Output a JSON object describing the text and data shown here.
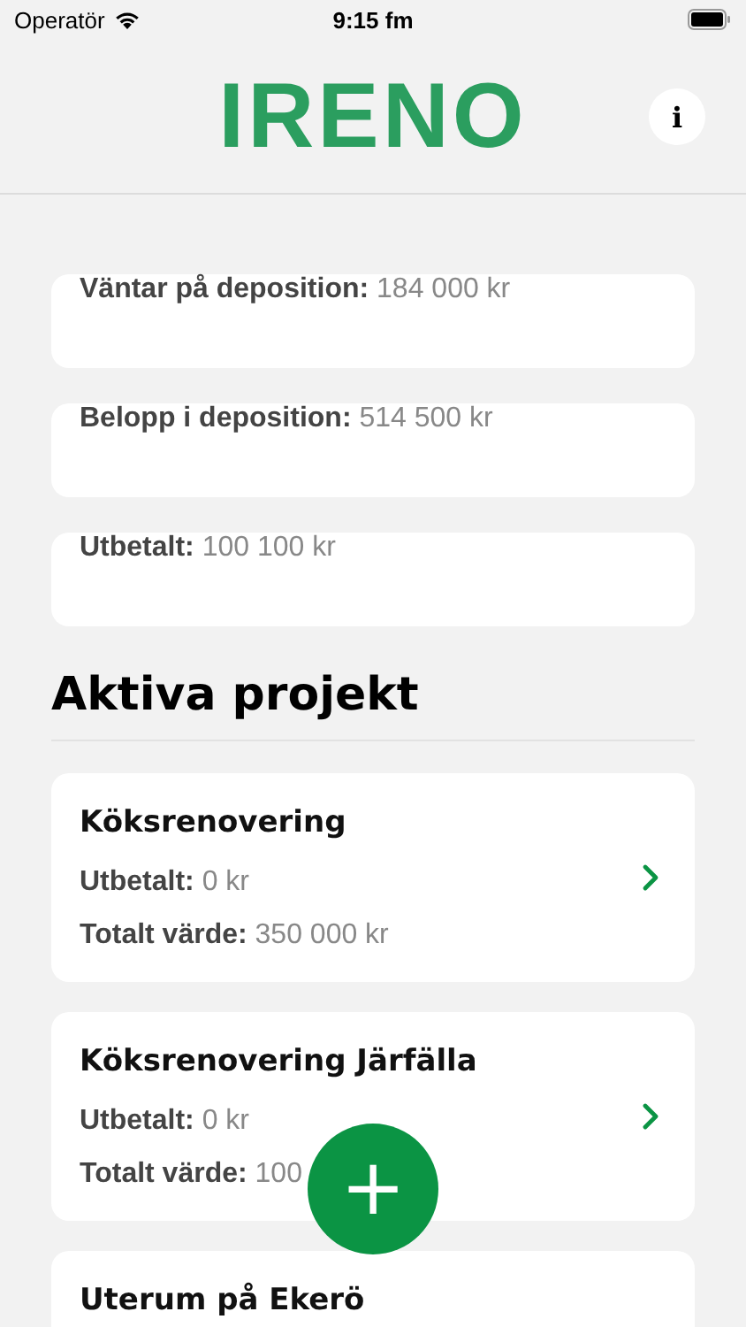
{
  "status_bar": {
    "carrier": "Operatör",
    "time": "9:15 fm"
  },
  "header": {
    "logo": "IRENO",
    "info_icon": "i"
  },
  "summary": [
    {
      "label": "Väntar på deposition:",
      "value": "184 000 kr"
    },
    {
      "label": "Belopp i deposition:",
      "value": "514 500 kr"
    },
    {
      "label": "Utbetalt:",
      "value": "100 100 kr"
    }
  ],
  "section_title": "Aktiva projekt",
  "projects": [
    {
      "title": "Köksrenovering",
      "lines": [
        {
          "label": "Utbetalt:",
          "value": "0 kr"
        },
        {
          "label": "Totalt värde:",
          "value": "350 000 kr"
        }
      ]
    },
    {
      "title": "Köksrenovering Järfälla",
      "lines": [
        {
          "label": "Utbetalt:",
          "value": "0 kr"
        },
        {
          "label": "Totalt värde:",
          "value": "100"
        }
      ]
    },
    {
      "title": "Uterum på Ekerö"
    }
  ],
  "fab": {
    "symbol": "+"
  }
}
